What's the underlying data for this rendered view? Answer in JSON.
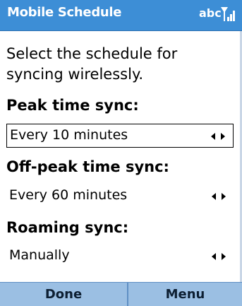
{
  "titlebar": {
    "title": "Mobile Schedule",
    "input_mode": "abc",
    "signal_icon": "signal-strength-icon"
  },
  "content": {
    "intro": "Select the schedule for syncing wirelessly.",
    "sections": [
      {
        "label": "Peak time sync:",
        "value": "Every 10 minutes",
        "selected": true
      },
      {
        "label": "Off-peak time sync:",
        "value": "Every 60 minutes",
        "selected": false
      },
      {
        "label": "Roaming sync:",
        "value": "Manually",
        "selected": false
      }
    ]
  },
  "softkeys": {
    "left": "Done",
    "right": "Menu"
  },
  "colors": {
    "titlebar": "#3d8ed6",
    "softkey_bar": "#9bbfe3",
    "text": "#000000"
  }
}
